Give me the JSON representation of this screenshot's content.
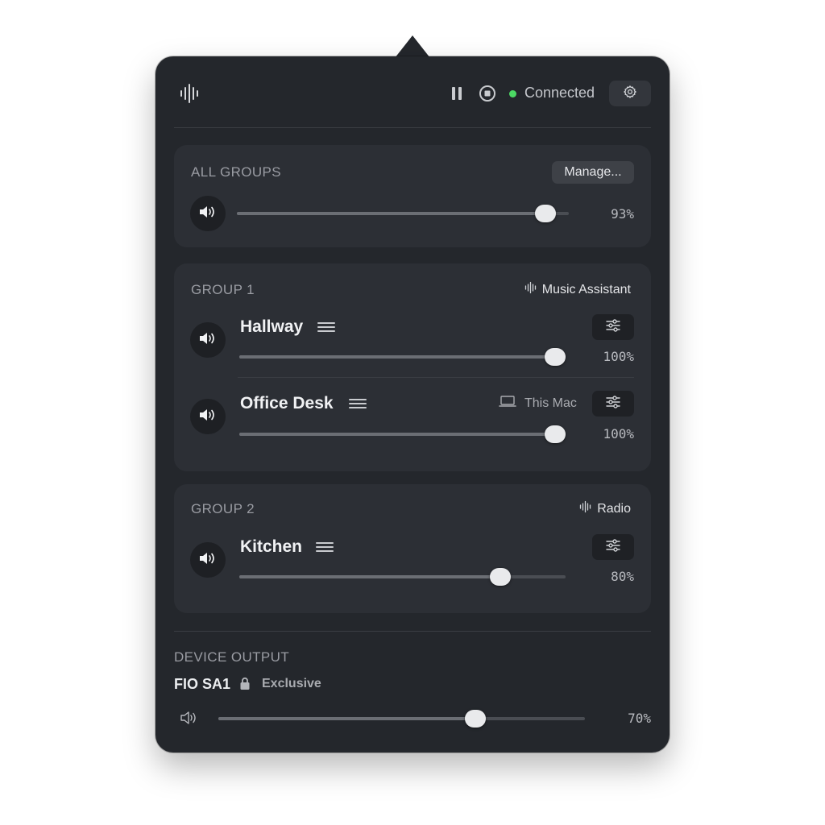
{
  "header": {
    "status_text": "Connected",
    "status_color": "#4cd964",
    "icons": [
      "waveform-logo-icon",
      "pause-icon",
      "stop-icon",
      "gear-icon"
    ]
  },
  "all_groups": {
    "title": "ALL GROUPS",
    "manage_label": "Manage...",
    "volume": 93,
    "volume_text": "93%"
  },
  "groups": [
    {
      "title": "GROUP 1",
      "source": "Music Assistant",
      "speakers": [
        {
          "name": "Hallway",
          "volume": 100,
          "volume_text": "100%"
        },
        {
          "name": "Office Desk",
          "volume": 100,
          "volume_text": "100%",
          "device_label": "This Mac"
        }
      ]
    },
    {
      "title": "GROUP 2",
      "source": "Radio",
      "speakers": [
        {
          "name": "Kitchen",
          "volume": 80,
          "volume_text": "80%"
        }
      ]
    }
  ],
  "device_output": {
    "title": "DEVICE OUTPUT",
    "device_name": "FIO SA1",
    "mode_label": "Exclusive",
    "volume": 70,
    "volume_text": "70%"
  }
}
